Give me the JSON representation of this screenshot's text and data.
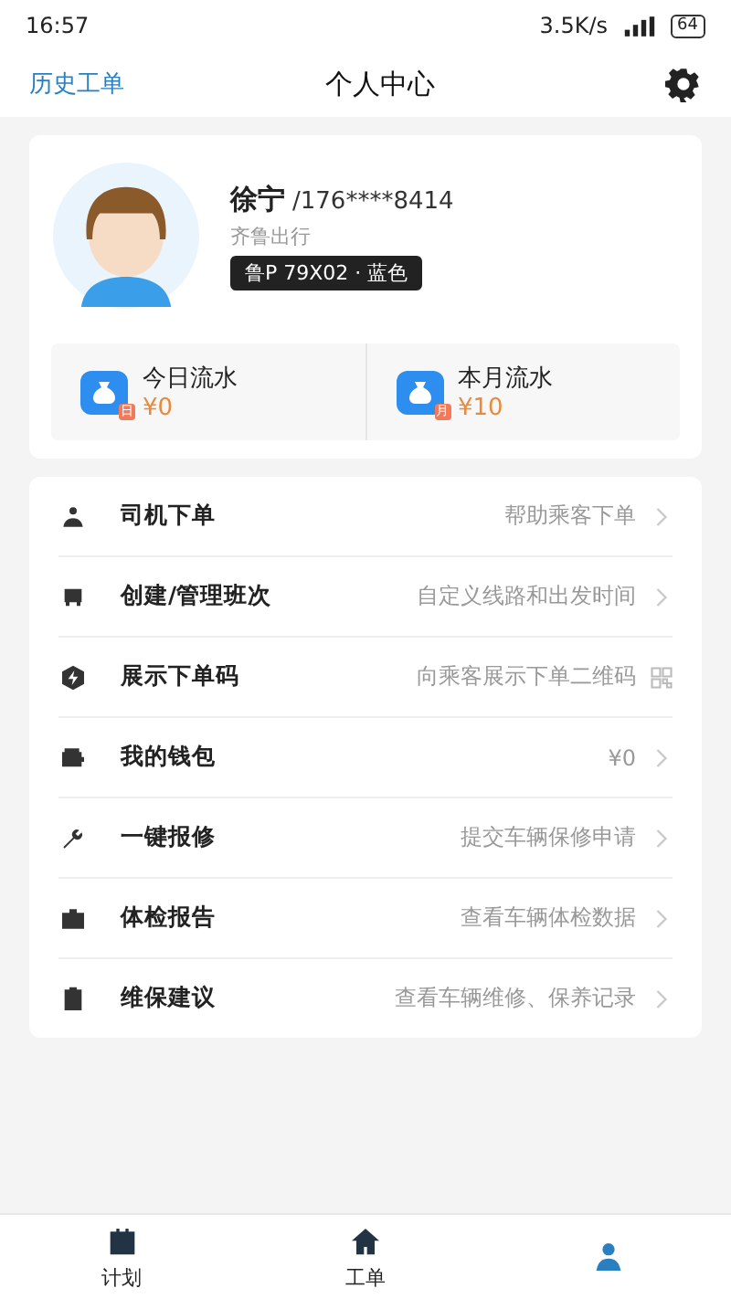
{
  "status_bar": {
    "time": "16:57",
    "speed": "3.5K/s",
    "battery": "64"
  },
  "header": {
    "left_link": "历史工单",
    "title": "个人中心"
  },
  "profile": {
    "name": "徐宁",
    "phone": "/176****8414",
    "company": "齐鲁出行",
    "plate": "鲁P 79X02 · 蓝色"
  },
  "earnings": [
    {
      "label": "今日流水",
      "badge": "日",
      "amount": "¥0"
    },
    {
      "label": "本月流水",
      "badge": "月",
      "amount": "¥10"
    }
  ],
  "menu": [
    {
      "label": "司机下单",
      "hint": "帮助乘客下单",
      "kind": "arrow"
    },
    {
      "label": "创建/管理班次",
      "hint": "自定义线路和出发时间",
      "kind": "arrow"
    },
    {
      "label": "展示下单码",
      "hint": "向乘客展示下单二维码",
      "kind": "qr"
    },
    {
      "label": "我的钱包",
      "hint": "¥0",
      "kind": "arrow"
    },
    {
      "label": "一键报修",
      "hint": "提交车辆保修申请",
      "kind": "arrow"
    },
    {
      "label": "体检报告",
      "hint": "查看车辆体检数据",
      "kind": "arrow"
    },
    {
      "label": "维保建议",
      "hint": "查看车辆维修、保养记录",
      "kind": "arrow"
    }
  ],
  "tab_bar": [
    {
      "label": "计划",
      "selected": false
    },
    {
      "label": "工单",
      "selected": false
    },
    {
      "selected": true
    }
  ]
}
